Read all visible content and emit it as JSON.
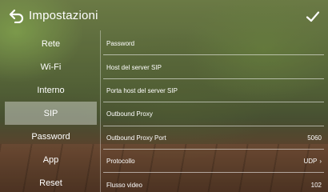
{
  "header": {
    "title": "Impostazioni",
    "back_icon": "back-arrow-icon",
    "confirm_icon": "checkmark-icon"
  },
  "tabs": [
    {
      "label": "Rete",
      "active": false
    },
    {
      "label": "Wi-Fi",
      "active": false
    },
    {
      "label": "Interno",
      "active": false
    },
    {
      "label": "SIP",
      "active": true
    },
    {
      "label": "Password",
      "active": false
    },
    {
      "label": "App",
      "active": false
    },
    {
      "label": "Reset",
      "active": false
    }
  ],
  "settings": [
    {
      "label": "Password",
      "value": ""
    },
    {
      "label": "Host del server SIP",
      "value": ""
    },
    {
      "label": "Porta host del server SIP",
      "value": ""
    },
    {
      "label": "Outbound Proxy",
      "value": ""
    },
    {
      "label": "Outbound Proxy Port",
      "value": "5060"
    },
    {
      "label": "Protocollo",
      "value": "UDP",
      "chevron": "›"
    },
    {
      "label": "Flusso video",
      "value": "102"
    }
  ]
}
